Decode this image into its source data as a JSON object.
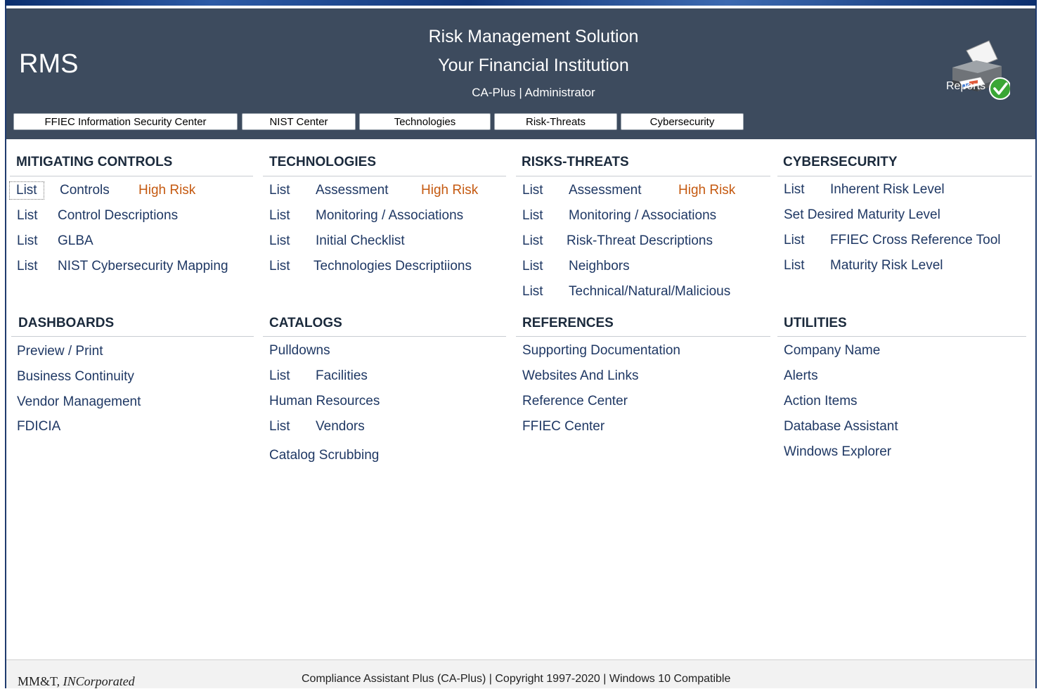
{
  "header": {
    "app_abbr": "RMS",
    "title": "Risk Management Solution",
    "institution": "Your Financial Institution",
    "user_line": "CA-Plus | Administrator",
    "reports_label": "Reports"
  },
  "nav": {
    "ffiec": "FFIEC Information Security Center",
    "nist": "NIST Center",
    "technologies": "Technologies",
    "risk_threats": "Risk-Threats",
    "cybersecurity": "Cybersecurity"
  },
  "mitigating": {
    "title": "MITIGATING CONTROLS",
    "row1": {
      "list": "List",
      "label": "Controls",
      "high": "High Risk"
    },
    "row2": {
      "list": "List",
      "label": "Control Descriptions"
    },
    "row3": {
      "list": "List",
      "label": "GLBA"
    },
    "row4": {
      "list": "List",
      "label": "NIST Cybersecurity Mapping"
    }
  },
  "technologies": {
    "title": "TECHNOLOGIES",
    "row1": {
      "list": "List",
      "label": "Assessment",
      "high": "High Risk"
    },
    "row2": {
      "list": "List",
      "label": "Monitoring / Associations"
    },
    "row3": {
      "list": "List",
      "label": "Initial Checklist"
    },
    "row4": {
      "list": "List",
      "label": "Technologies Descriptiions"
    }
  },
  "risks": {
    "title": "RISKS-THREATS",
    "row1": {
      "list": "List",
      "label": "Assessment",
      "high": "High Risk"
    },
    "row2": {
      "list": "List",
      "label": "Monitoring / Associations"
    },
    "row3": {
      "list": "List",
      "label": "Risk-Threat Descriptions"
    },
    "row4": {
      "list": "List",
      "label": "Neighbors"
    },
    "row5": {
      "list": "List",
      "label": "Technical/Natural/Malicious"
    }
  },
  "cyber": {
    "title": "CYBERSECURITY",
    "row1": {
      "list": "List",
      "label": "Inherent Risk Level"
    },
    "row2": {
      "label": "Set Desired Maturity Level"
    },
    "row3": {
      "list": "List",
      "label": "FFIEC Cross Reference Tool"
    },
    "row4": {
      "list": "List",
      "label": "Maturity Risk Level"
    }
  },
  "dashboards": {
    "title": "DASHBOARDS",
    "items": [
      "Preview / Print",
      "Business Continuity",
      "Vendor Management",
      "FDICIA"
    ]
  },
  "catalogs": {
    "title": "CATALOGS",
    "pulldowns": "Pulldowns",
    "facilities": {
      "list": "List",
      "label": "Facilities"
    },
    "human_resources": "Human Resources",
    "vendors": {
      "list": "List",
      "label": "Vendors"
    },
    "scrubbing": "Catalog Scrubbing"
  },
  "references": {
    "title": "REFERENCES",
    "items": [
      "Supporting Documentation",
      "Websites And Links",
      "Reference Center",
      "FFIEC Center"
    ]
  },
  "utilities": {
    "title": "UTILITIES",
    "items": [
      "Company Name",
      "Alerts",
      "Action Items",
      "Database Assistant",
      "Windows Explorer"
    ]
  },
  "footer": {
    "company_prefix": "MM&T, ",
    "company_suffix": "INCorporated",
    "copyright": "Compliance Assistant Plus (CA-Plus) | Copyright 1997-2020 | Windows  10 Compatible"
  },
  "colors": {
    "header_bg": "#3d4b5e",
    "link": "#1f3864",
    "high_risk": "#c55a11",
    "section_title": "#1b2a3c"
  },
  "icons": {
    "reports": "printer-with-checkmark-icon"
  }
}
